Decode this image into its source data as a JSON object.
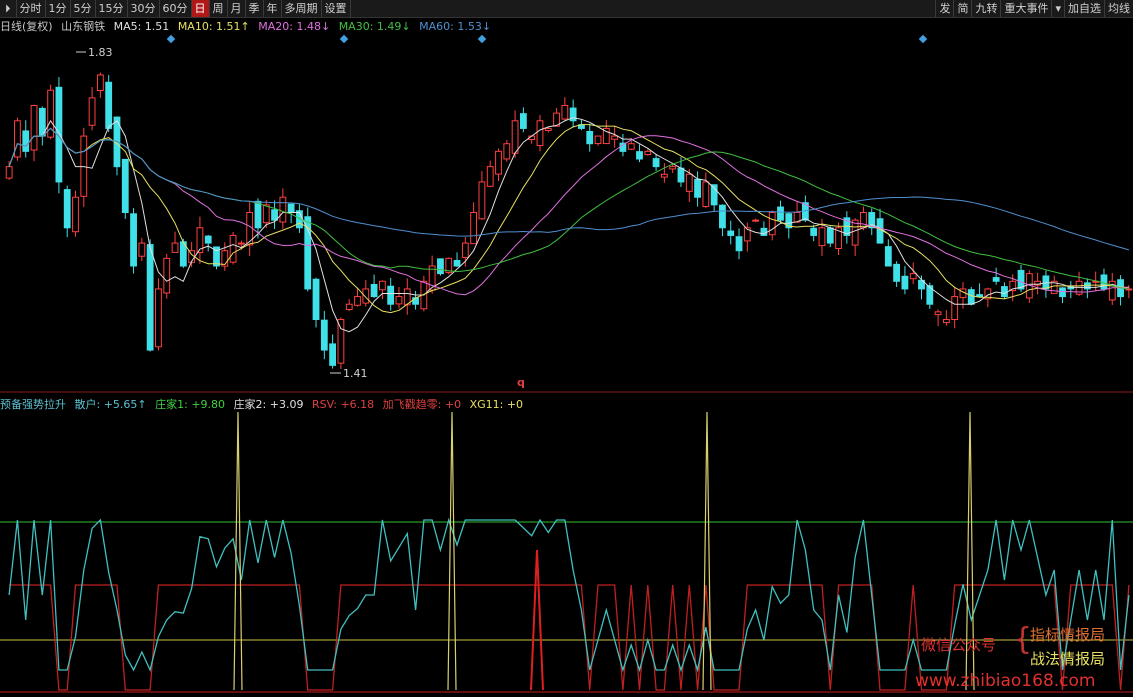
{
  "toolbar": {
    "left": [
      "分时",
      "1分",
      "5分",
      "15分",
      "30分",
      "60分",
      "日",
      "周",
      "月",
      "季",
      "年",
      "多周期",
      "设置"
    ],
    "active": "日",
    "right": [
      "发",
      "简",
      "九转",
      "重大事件",
      "加自选",
      "均线"
    ]
  },
  "main_info": {
    "period": "日线(复权)",
    "stock": "山东钢铁",
    "ma5": "MA5: 1.51",
    "ma10": "MA10: 1.51↑",
    "ma20": "MA20: 1.48↓",
    "ma30": "MA30: 1.49↓",
    "ma60": "MA60: 1.53↓"
  },
  "price_labels": {
    "high": "1.83",
    "low": "1.41",
    "marker": "q"
  },
  "indicator_info": {
    "name": "预备强势拉升",
    "sanhu": "散户: +5.65↑",
    "zhuang1": "庄家1: +9.80",
    "zhuang2": "庄家2: +3.09",
    "rsv": "RSV: +6.18",
    "jiafei": "加飞戳趋零: +0",
    "xg11": "XG11: +0"
  },
  "watermark": {
    "line1": "微信公众号",
    "line2a": "指标情报局",
    "line2b": "战法情报局",
    "url": "www.zhibiao168.com"
  },
  "colors": {
    "up": "#ff4040",
    "down": "#40e0e8",
    "ma5": "#e0e0e0",
    "ma10": "#e8e060",
    "ma20": "#e070e0",
    "ma30": "#40c040",
    "ma60": "#4f8fd0",
    "accent": "#b01818"
  },
  "chart_data": {
    "type": "candlestick",
    "x_count": 136,
    "high_label": 1.83,
    "low_label": 1.41,
    "closes": [
      1.68,
      1.74,
      1.7,
      1.76,
      1.72,
      1.78,
      1.66,
      1.6,
      1.64,
      1.72,
      1.77,
      1.8,
      1.73,
      1.68,
      1.62,
      1.55,
      1.58,
      1.44,
      1.52,
      1.56,
      1.58,
      1.55,
      1.57,
      1.6,
      1.58,
      1.55,
      1.57,
      1.59,
      1.58,
      1.62,
      1.6,
      1.63,
      1.61,
      1.64,
      1.62,
      1.6,
      1.52,
      1.48,
      1.44,
      1.42,
      1.48,
      1.5,
      1.51,
      1.52,
      1.51,
      1.53,
      1.5,
      1.51,
      1.52,
      1.5,
      1.53,
      1.55,
      1.54,
      1.56,
      1.55,
      1.58,
      1.62,
      1.66,
      1.68,
      1.7,
      1.71,
      1.74,
      1.73,
      1.72,
      1.74,
      1.73,
      1.75,
      1.76,
      1.74,
      1.73,
      1.71,
      1.72,
      1.73,
      1.72,
      1.7,
      1.71,
      1.69,
      1.7,
      1.68,
      1.67,
      1.68,
      1.66,
      1.67,
      1.64,
      1.66,
      1.63,
      1.6,
      1.59,
      1.57,
      1.6,
      1.61,
      1.59,
      1.62,
      1.61,
      1.6,
      1.62,
      1.61,
      1.59,
      1.6,
      1.58,
      1.6,
      1.59,
      1.61,
      1.62,
      1.6,
      1.58,
      1.55,
      1.53,
      1.52,
      1.54,
      1.52,
      1.5,
      1.49,
      1.48,
      1.51,
      1.52,
      1.5,
      1.51,
      1.52,
      1.53,
      1.51,
      1.53,
      1.52,
      1.54,
      1.53,
      1.52,
      1.53,
      1.51,
      1.52,
      1.53,
      1.52,
      1.53,
      1.52,
      1.53,
      1.51,
      1.52
    ]
  }
}
